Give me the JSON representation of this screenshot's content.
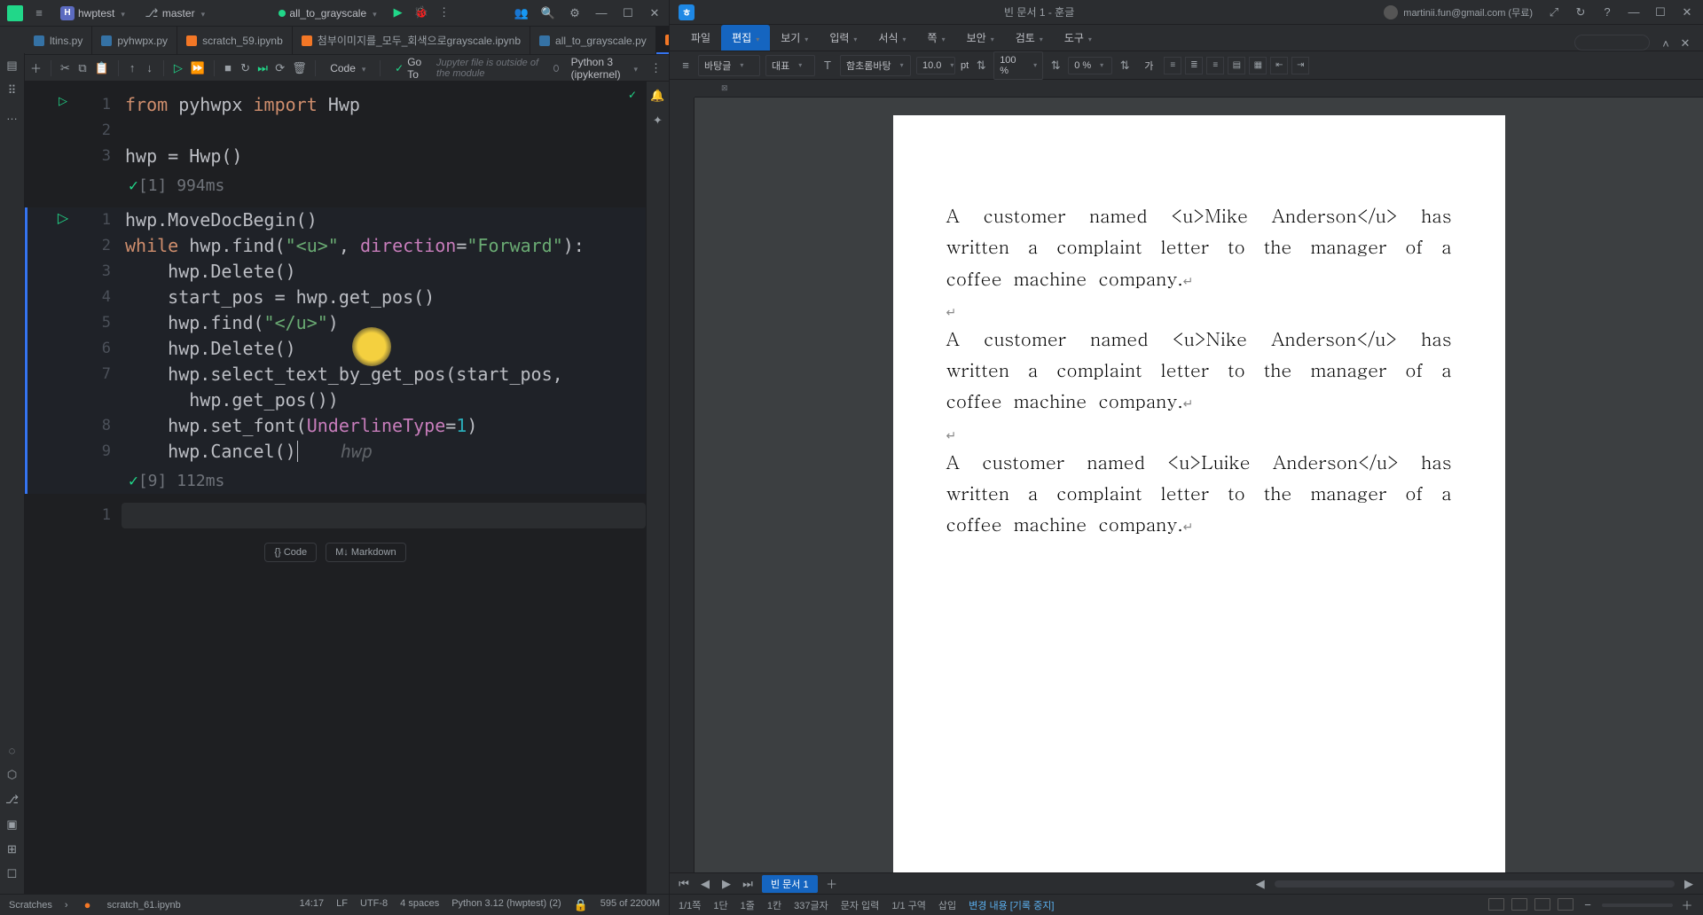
{
  "pycharm": {
    "project_initial": "H",
    "project_name": "hwptest",
    "branch": "master",
    "run_config": "all_to_grayscale",
    "tabs": [
      {
        "name": "ltins.py",
        "type": "py",
        "active": false
      },
      {
        "name": "pyhwpx.py",
        "type": "py",
        "active": false
      },
      {
        "name": "scratch_59.ipynb",
        "type": "nb",
        "active": false
      },
      {
        "name": "첨부이미지를_모두_회색으로grayscale.ipynb",
        "type": "nb",
        "active": false
      },
      {
        "name": "all_to_grayscale.py",
        "type": "py",
        "active": false
      },
      {
        "name": "scratch_61.ipynb",
        "type": "nb",
        "active": true
      }
    ],
    "toolbar": {
      "code_label": "Code",
      "goto_label": "Go To",
      "warning": "Jupyter file is outside of the module",
      "kernel": "Python 3 (ipykernel)"
    },
    "cell1": {
      "lines": [
        "1",
        "2",
        "3"
      ],
      "out_index": "[1]",
      "out_time": "994ms"
    },
    "cell2": {
      "lines": [
        "1",
        "2",
        "3",
        "4",
        "5",
        "6",
        "7",
        "8",
        "9"
      ],
      "inlay": "hwp",
      "out_index": "[9]",
      "out_time": "112ms"
    },
    "cell3": {
      "lines": [
        "1"
      ]
    },
    "add_code": "Code",
    "add_md": "Markdown",
    "status": {
      "path1": "Scratches",
      "path2": "scratch_61.ipynb",
      "pos": "14:17",
      "lf": "LF",
      "enc": "UTF-8",
      "indent": "4 spaces",
      "interp": "Python 3.12 (hwptest) (2)",
      "mem": "595 of 2200M"
    },
    "code1_l1_from": "from",
    "code1_l1_mod": "pyhwpx",
    "code1_l1_import": "import",
    "code1_l1_cls": "Hwp",
    "code1_l3": "hwp = Hwp()",
    "code2": {
      "l1": "hwp.MoveDocBegin()",
      "l2_while": "while",
      "l2_a": " hwp.find(",
      "l2_str": "\"<u>\"",
      "l2_b": ", ",
      "l2_param": "direction",
      "l2_c": "=",
      "l2_val": "\"Forward\"",
      "l2_d": "):",
      "l3": "    hwp.Delete()",
      "l4": "    start_pos = hwp.get_pos()",
      "l5_a": "    hwp.find(",
      "l5_str": "\"</u>\"",
      "l5_b": ")",
      "l6": "    hwp.Delete()",
      "l7a": "    hwp.select_text_by_get_pos(start_pos,",
      "l7b": "      hwp.get_pos())",
      "l8_a": "    hwp.set_font(",
      "l8_param": "UnderlineType",
      "l8_b": "=",
      "l8_num": "1",
      "l8_c": ")",
      "l9": "    hwp.Cancel()"
    }
  },
  "hwp": {
    "title": "빈 문서 1 - 훈글",
    "user": "martinii.fun@gmail.com (무료)",
    "menu": [
      "파일",
      "편집",
      "보기",
      "입력",
      "서식",
      "쪽",
      "보안",
      "검토",
      "도구"
    ],
    "menu_active_index": 1,
    "format": {
      "style": "바탕글",
      "rep": "대표",
      "font": "함초롬바탕",
      "size": "10.0",
      "size_unit": "pt",
      "zoom1": "100 %",
      "zoom2": "0 %",
      "ga": "가"
    },
    "doc_tab": "빈 문서 1",
    "paragraphs": [
      "A customer named <u>Mike Anderson</u> has written a complaint letter to the manager of a coffee machine company.",
      "A customer named <u>Nike Anderson</u> has written a complaint letter to the manager of a coffee machine company.",
      "A customer named <u>Luike Anderson</u> has written a complaint letter to the manager of a coffee machine company."
    ],
    "status": {
      "page": "1/1쪽",
      "dan": "1단",
      "line": "1줄",
      "col": "1칸",
      "chars": "337글자",
      "mode": "문자 입력",
      "section": "1/1 구역",
      "insert": "삽입",
      "change": "변경 내용 [기록 중지]"
    }
  }
}
